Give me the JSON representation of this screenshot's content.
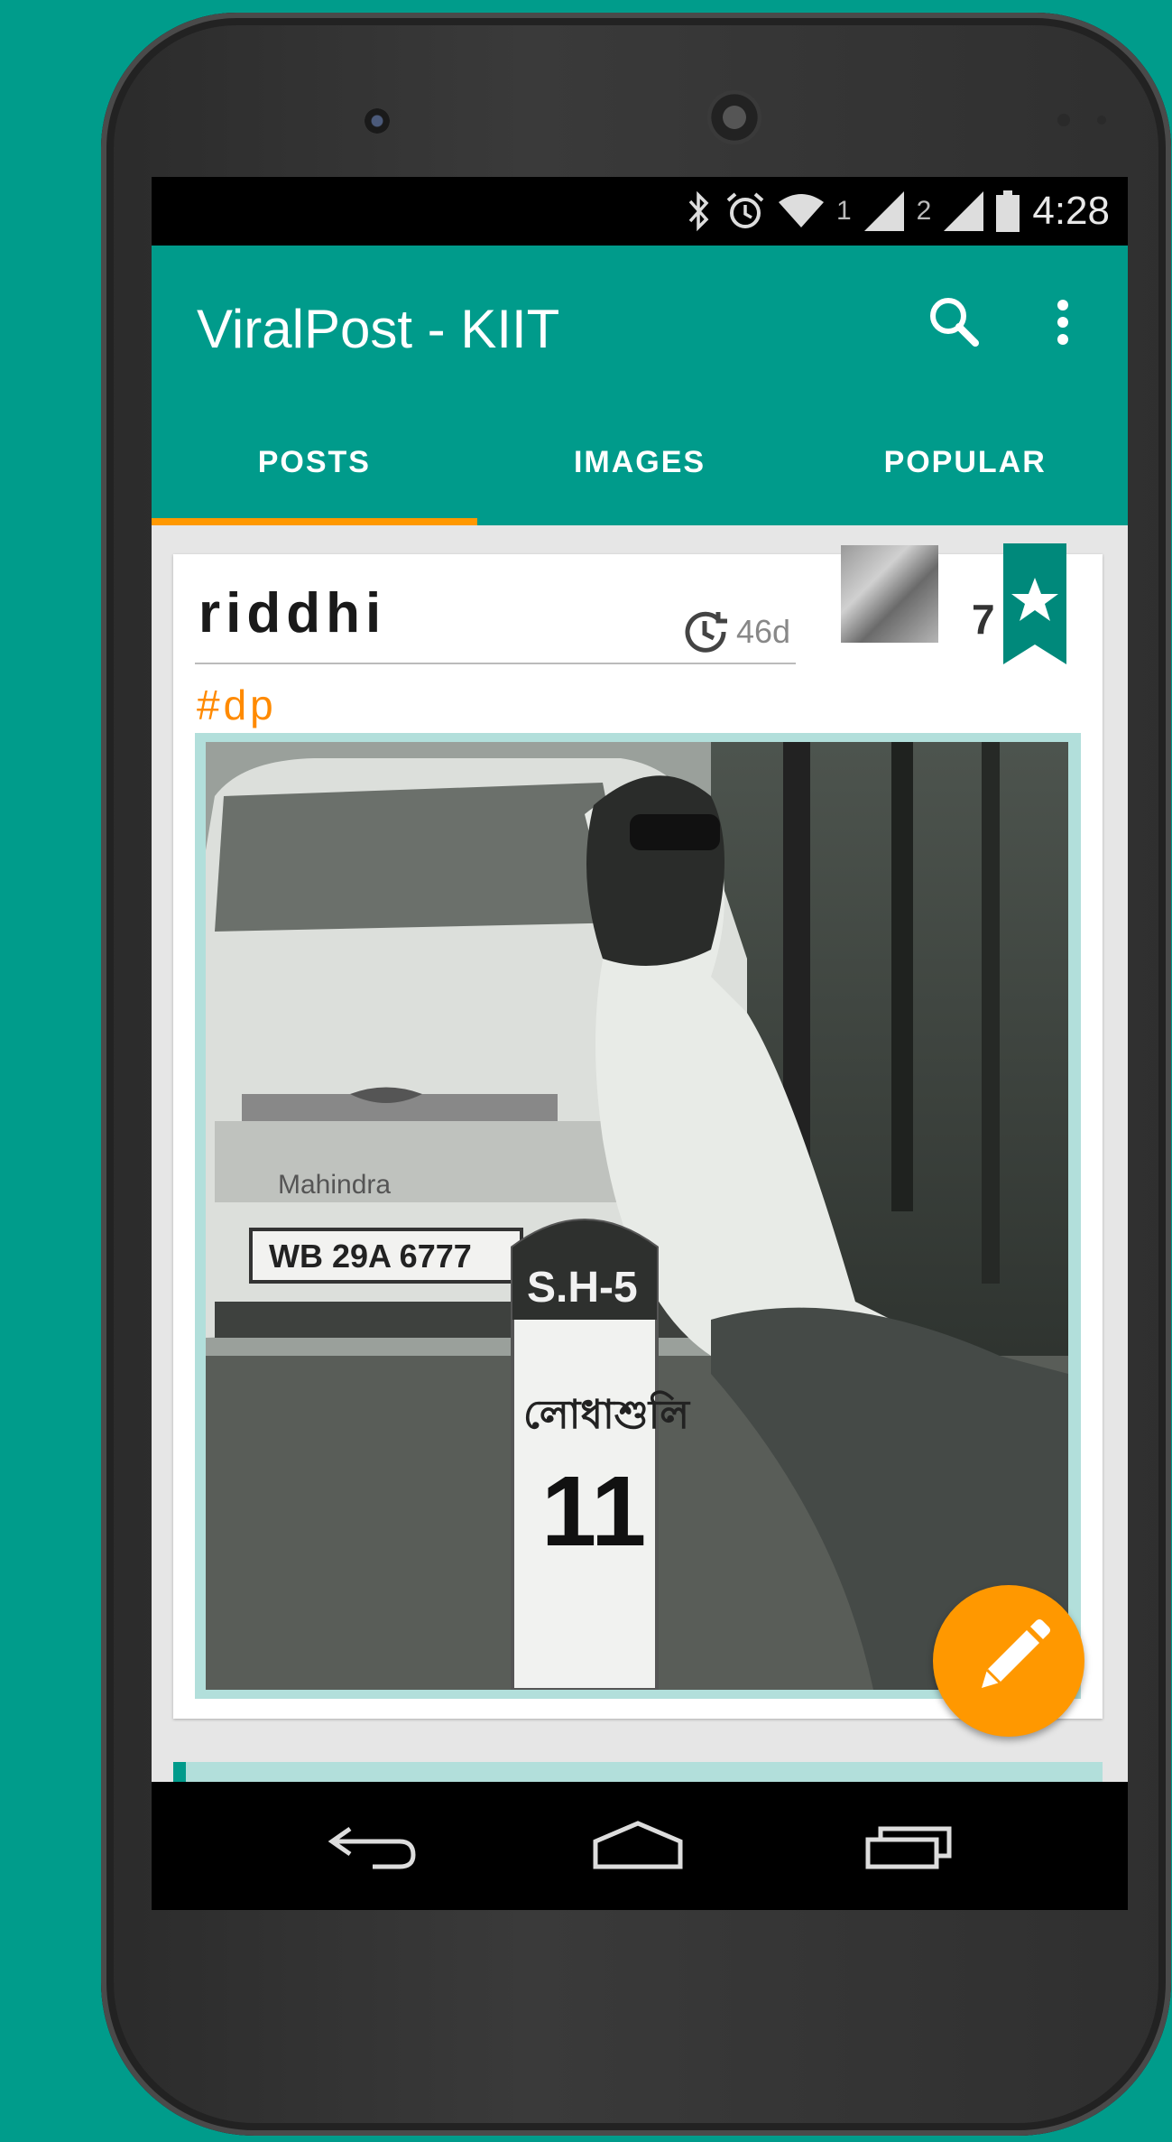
{
  "status_bar": {
    "sim1": "1",
    "sim2": "2",
    "time": "4:28",
    "icons": [
      "bluetooth-icon",
      "alarm-icon",
      "wifi-icon",
      "signal-icon",
      "signal-icon",
      "battery-icon"
    ]
  },
  "app_bar": {
    "title": "ViralPost - KIIT",
    "actions": [
      "search-icon",
      "more-vert-icon"
    ]
  },
  "tabs": [
    {
      "label": "POSTS",
      "active": true
    },
    {
      "label": "IMAGES",
      "active": false
    },
    {
      "label": "POPULAR",
      "active": false
    }
  ],
  "post": {
    "username": "riddhi",
    "time_ago": "46d",
    "votes": "7",
    "hashtag": "#dp",
    "image_text": {
      "car_brand": "Mahindra",
      "license_plate": "WB 29A 6777",
      "milestone_route": "S.H-5",
      "milestone_place": "লোধাশুলি",
      "milestone_number": "11"
    }
  },
  "colors": {
    "primary": "#009b8b",
    "accent": "#ff9800",
    "tab_indicator": "#ff9800",
    "photo_frame": "#b2dfdb"
  }
}
